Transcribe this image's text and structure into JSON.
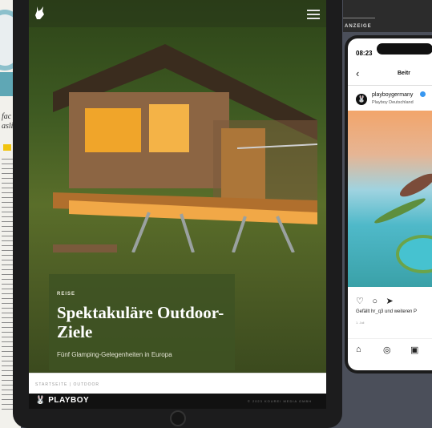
{
  "magazine_left": {
    "snippet": "fac\nasli"
  },
  "tablet": {
    "topbar": {
      "logo_icon": "bunny-logo-icon",
      "menu_icon": "hamburger-menu-icon"
    },
    "article": {
      "kicker": "REISE",
      "headline": "Spektakuläre Outdoor-Ziele",
      "subline": "Fünf Glamping-Gelegenheiten in Europa"
    },
    "breadcrumb": "STARTSEITE | OUTDOOR",
    "brand": "PLAYBOY",
    "copyright": "© 2023 KOUREI MEDIA GMBH"
  },
  "ad_label": "ANZEIGE",
  "phone": {
    "time": "08:23",
    "title": "Beitr",
    "account": {
      "handle": "playboygermany",
      "name": "Playboy Deutschland"
    },
    "likes": "Gefällt hr_q3 und weiteren P",
    "date": "1. Juli",
    "icons": [
      "heart-icon",
      "comment-icon",
      "share-icon",
      "home-icon",
      "explore-icon",
      "reels-icon"
    ]
  }
}
